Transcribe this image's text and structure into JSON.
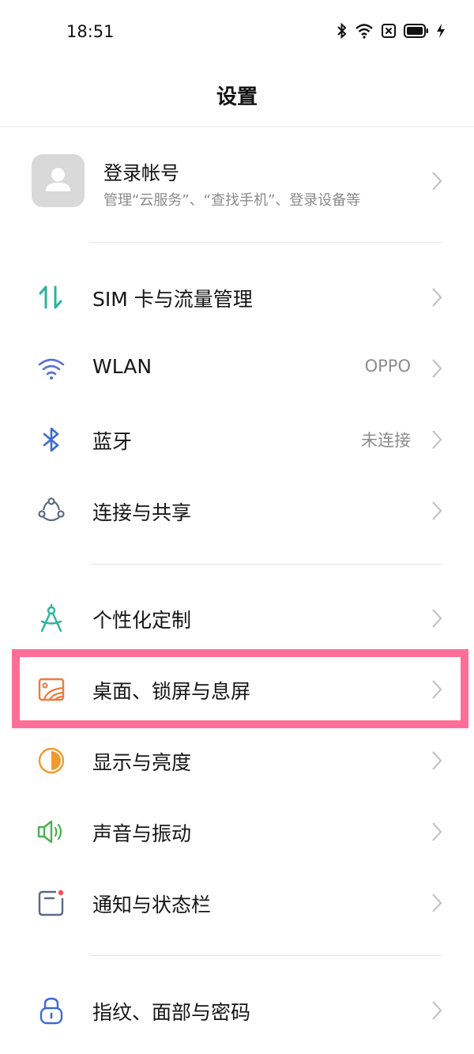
{
  "status_bar": {
    "time": "18:51",
    "icons": [
      "bluetooth-icon",
      "wifi-icon",
      "sim-off-icon",
      "battery-icon",
      "charging-icon"
    ]
  },
  "header": {
    "title": "设置"
  },
  "account": {
    "name": "登录帐号",
    "subtitle": "管理“云服务”、“查找手机”、登录设备等",
    "avatar_icon": "person-icon"
  },
  "groups": [
    {
      "items": [
        {
          "id": "sim",
          "label": "SIM 卡与流量管理",
          "icon": "data-transfer-icon",
          "icon_color": "#2bb39b"
        },
        {
          "id": "wlan",
          "label": "WLAN",
          "value": "OPPO",
          "icon": "wifi-icon",
          "icon_color": "#5b6fd6"
        },
        {
          "id": "bluetooth",
          "label": "蓝牙",
          "value": "未连接",
          "icon": "bluetooth-icon",
          "icon_color": "#3e6ad3"
        },
        {
          "id": "connection",
          "label": "连接与共享",
          "icon": "share-network-icon",
          "icon_color": "#5a6a85"
        }
      ]
    },
    {
      "items": [
        {
          "id": "personalize",
          "label": "个性化定制",
          "icon": "compass-icon",
          "icon_color": "#2bb39b"
        },
        {
          "id": "homescreen",
          "label": "桌面、锁屏与息屏",
          "icon": "wallpaper-icon",
          "icon_color": "#ef7a3c",
          "highlighted": true
        },
        {
          "id": "display",
          "label": "显示与亮度",
          "icon": "brightness-icon",
          "icon_color": "#f29a2e"
        },
        {
          "id": "sound",
          "label": "声音与振动",
          "icon": "speaker-icon",
          "icon_color": "#4caf50"
        },
        {
          "id": "notification",
          "label": "通知与状态栏",
          "icon": "notification-icon",
          "icon_color": "#5a6a85"
        }
      ]
    },
    {
      "items": [
        {
          "id": "security",
          "label": "指纹、面部与密码",
          "icon": "lock-icon",
          "icon_color": "#3e6ad3"
        }
      ]
    }
  ],
  "highlight_color": "#ff6e97"
}
